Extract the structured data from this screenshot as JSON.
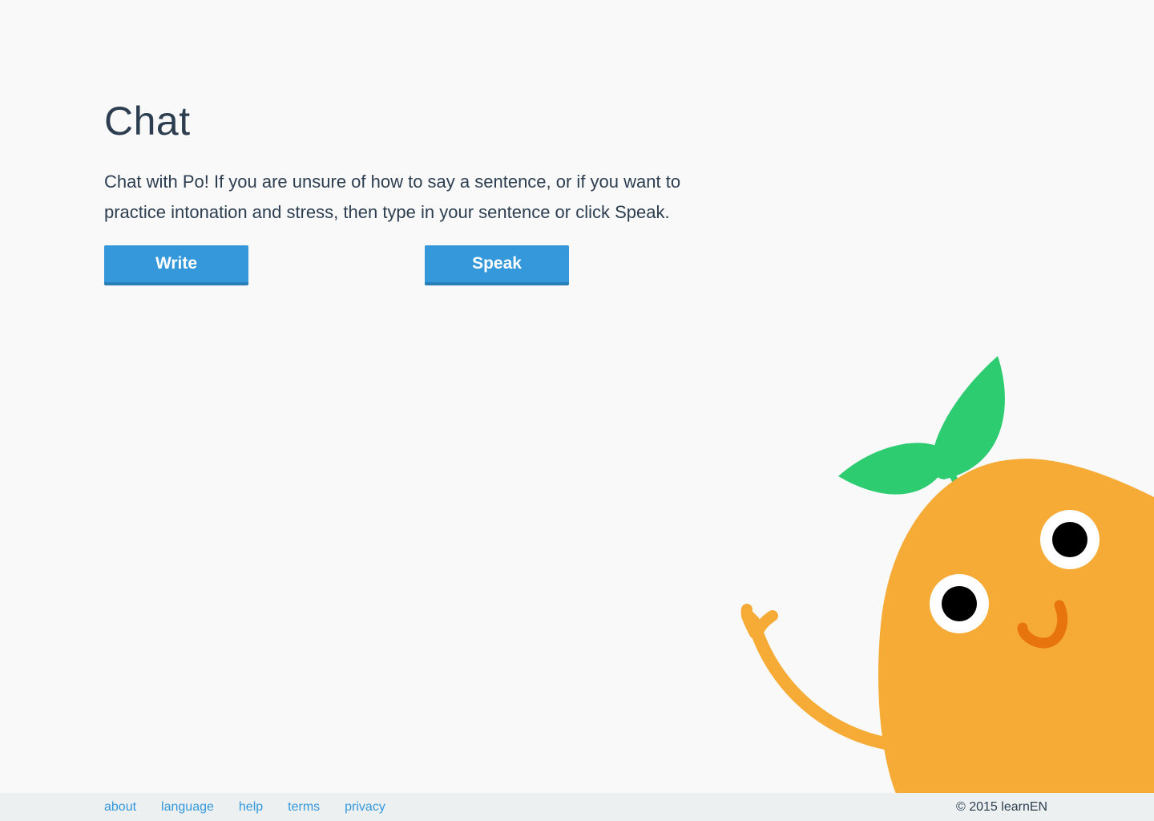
{
  "main": {
    "title": "Chat",
    "description": "Chat with Po! If you are unsure of how to say a sentence, or if you want to practice intonation and stress, then type in your sentence or click Speak.",
    "buttons": {
      "write": "Write",
      "speak": "Speak"
    }
  },
  "footer": {
    "links": {
      "about": "about",
      "language": "language",
      "help": "help",
      "terms": "terms",
      "privacy": "privacy"
    },
    "copyright": "© 2015 learnEN"
  },
  "colors": {
    "background": "#f9f9f9",
    "text": "#2c3e50",
    "accent": "#3498db",
    "footer_bg": "#ecf0f1",
    "mascot_body": "#f5ab35",
    "mascot_leaf": "#2ecc71",
    "mascot_smile": "#e8740e"
  },
  "mascot": {
    "icon": "po-mascot-icon"
  }
}
